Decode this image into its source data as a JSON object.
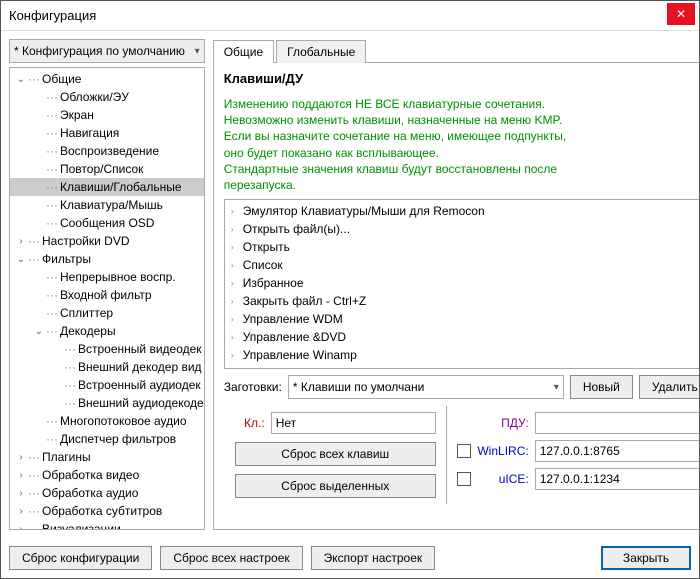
{
  "window": {
    "title": "Конфигурация"
  },
  "config_combo": {
    "value": "* Конфигурация по умолчанию"
  },
  "tree": [
    {
      "d": 0,
      "exp": "open",
      "label": "Общие"
    },
    {
      "d": 1,
      "exp": "",
      "label": "Обложки/ЭУ"
    },
    {
      "d": 1,
      "exp": "",
      "label": "Экран"
    },
    {
      "d": 1,
      "exp": "",
      "label": "Навигация"
    },
    {
      "d": 1,
      "exp": "",
      "label": "Воспроизведение"
    },
    {
      "d": 1,
      "exp": "",
      "label": "Повтор/Список"
    },
    {
      "d": 1,
      "exp": "",
      "label": "Клавиши/Глобальные",
      "sel": true
    },
    {
      "d": 1,
      "exp": "",
      "label": "Клавиатура/Мышь"
    },
    {
      "d": 1,
      "exp": "",
      "label": "Сообщения OSD"
    },
    {
      "d": 0,
      "exp": "closed",
      "label": "Настройки DVD"
    },
    {
      "d": 0,
      "exp": "open",
      "label": "Фильтры"
    },
    {
      "d": 1,
      "exp": "",
      "label": "Непрерывное воспр."
    },
    {
      "d": 1,
      "exp": "",
      "label": "Входной фильтр"
    },
    {
      "d": 1,
      "exp": "",
      "label": "Сплиттер"
    },
    {
      "d": 1,
      "exp": "open",
      "label": "Декодеры"
    },
    {
      "d": 2,
      "exp": "",
      "label": "Встроенный видеодек"
    },
    {
      "d": 2,
      "exp": "",
      "label": "Внешний декодер вид"
    },
    {
      "d": 2,
      "exp": "",
      "label": "Встроенный аудиодек"
    },
    {
      "d": 2,
      "exp": "",
      "label": "Внешний аудиодекоде"
    },
    {
      "d": 1,
      "exp": "",
      "label": "Многопотоковое аудио"
    },
    {
      "d": 1,
      "exp": "",
      "label": "Диспетчер фильтров"
    },
    {
      "d": 0,
      "exp": "closed",
      "label": "Плагины"
    },
    {
      "d": 0,
      "exp": "closed",
      "label": "Обработка видео"
    },
    {
      "d": 0,
      "exp": "closed",
      "label": "Обработка аудио"
    },
    {
      "d": 0,
      "exp": "closed",
      "label": "Обработка субтитров"
    },
    {
      "d": 0,
      "exp": "closed",
      "label": "Визуализации"
    }
  ],
  "tabs": {
    "active": "Общие",
    "inactive": "Глобальные"
  },
  "panel": {
    "title": "Клавиши/ДУ",
    "info": [
      "Изменению поддаются НЕ ВСЕ клавиатурные сочетания.",
      "Невозможно изменить клавиши, назначенные на меню KMP.",
      "Если вы назначите сочетание на меню, имеющее подпункты,",
      "оно будет показано как всплывающее.",
      "Стандартные значения клавиш будут восстановлены после",
      "перезапуска."
    ],
    "list": [
      "Эмулятор Клавиатуры/Мыши для Remocon",
      "Открыть файл(ы)...",
      "Открыть",
      "Список",
      "Избранное",
      "Закрыть файл - Ctrl+Z",
      "Управление WDM",
      "Управление &DVD",
      "Управление Winamp"
    ],
    "preset_label": "Заготовки:",
    "preset_value": "* Клавиши по умолчани",
    "new_btn": "Новый",
    "delete_btn": "Удалить",
    "key_label": "Кл.:",
    "key_value": "Нет",
    "reset_all_keys": "Сброс всех клавиш",
    "reset_selected": "Сброс выделенных",
    "pdu_label": "ПДУ:",
    "pdu_value": "",
    "winlirc_label": "WinLIRC:",
    "winlirc_value": "127.0.0.1:8765",
    "uice_label": "uICE:",
    "uice_value": "127.0.0.1:1234"
  },
  "footer": {
    "reset_config": "Сброс конфигурации",
    "reset_all": "Сброс всех настроек",
    "export": "Экспорт настроек",
    "close": "Закрыть"
  }
}
